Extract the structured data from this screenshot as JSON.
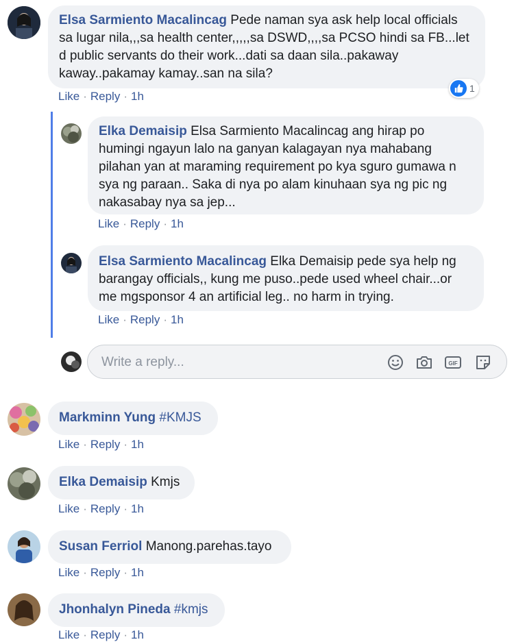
{
  "actions": {
    "like": "Like",
    "reply": "Reply",
    "separator": "·"
  },
  "comments": [
    {
      "name": "Elsa Sarmiento Macalincag",
      "text": "Pede naman sya ask help local officials sa lugar nila,,,sa health center,,,,,sa DSWD,,,,sa PCSO hindi sa FB...let d public servants do their work...dati sa daan sila..pakaway kaway..pakamay kamay..san na sila?",
      "time": "1h",
      "reaction_count": "1"
    },
    {
      "name": "Elka Demaisip",
      "text": "Elsa Sarmiento Macalincag ang hirap po humingi ngayun lalo na ganyan kalagayan nya mahabang pilahan yan at maraming requirement po kya sguro gumawa n sya ng paraan.. Saka di nya po alam kinuhaan sya ng pic ng nakasabay nya sa jep...",
      "time": "1h"
    },
    {
      "name": "Elsa Sarmiento Macalincag",
      "text": "Elka Demaisip pede sya help ng barangay officials,, kung me puso..pede used wheel chair...or me mgsponsor 4 an artificial leg.. no harm in trying.",
      "time": "1h"
    },
    {
      "name": "Markminn Yung",
      "text": "#KMJS",
      "time": "1h"
    },
    {
      "name": "Elka Demaisip",
      "text": "Kmjs",
      "time": "1h"
    },
    {
      "name": "Susan Ferriol",
      "text": "Manong.parehas.tayo",
      "time": "1h"
    },
    {
      "name": "Jhonhalyn Pineda",
      "text": "#kmjs",
      "time": "1h"
    }
  ],
  "reply_box": {
    "placeholder": "Write a reply..."
  },
  "icons": {
    "emoji": "emoji-icon",
    "camera": "camera-icon",
    "gif": "gif-icon",
    "gif_label": "GIF",
    "sticker": "sticker-icon",
    "like_reaction": "thumbs-up-icon"
  },
  "colors": {
    "name_link": "#385898",
    "bubble_bg": "#f0f2f5",
    "thread_line": "#4f7ee8",
    "like_blue": "#1877f2"
  }
}
